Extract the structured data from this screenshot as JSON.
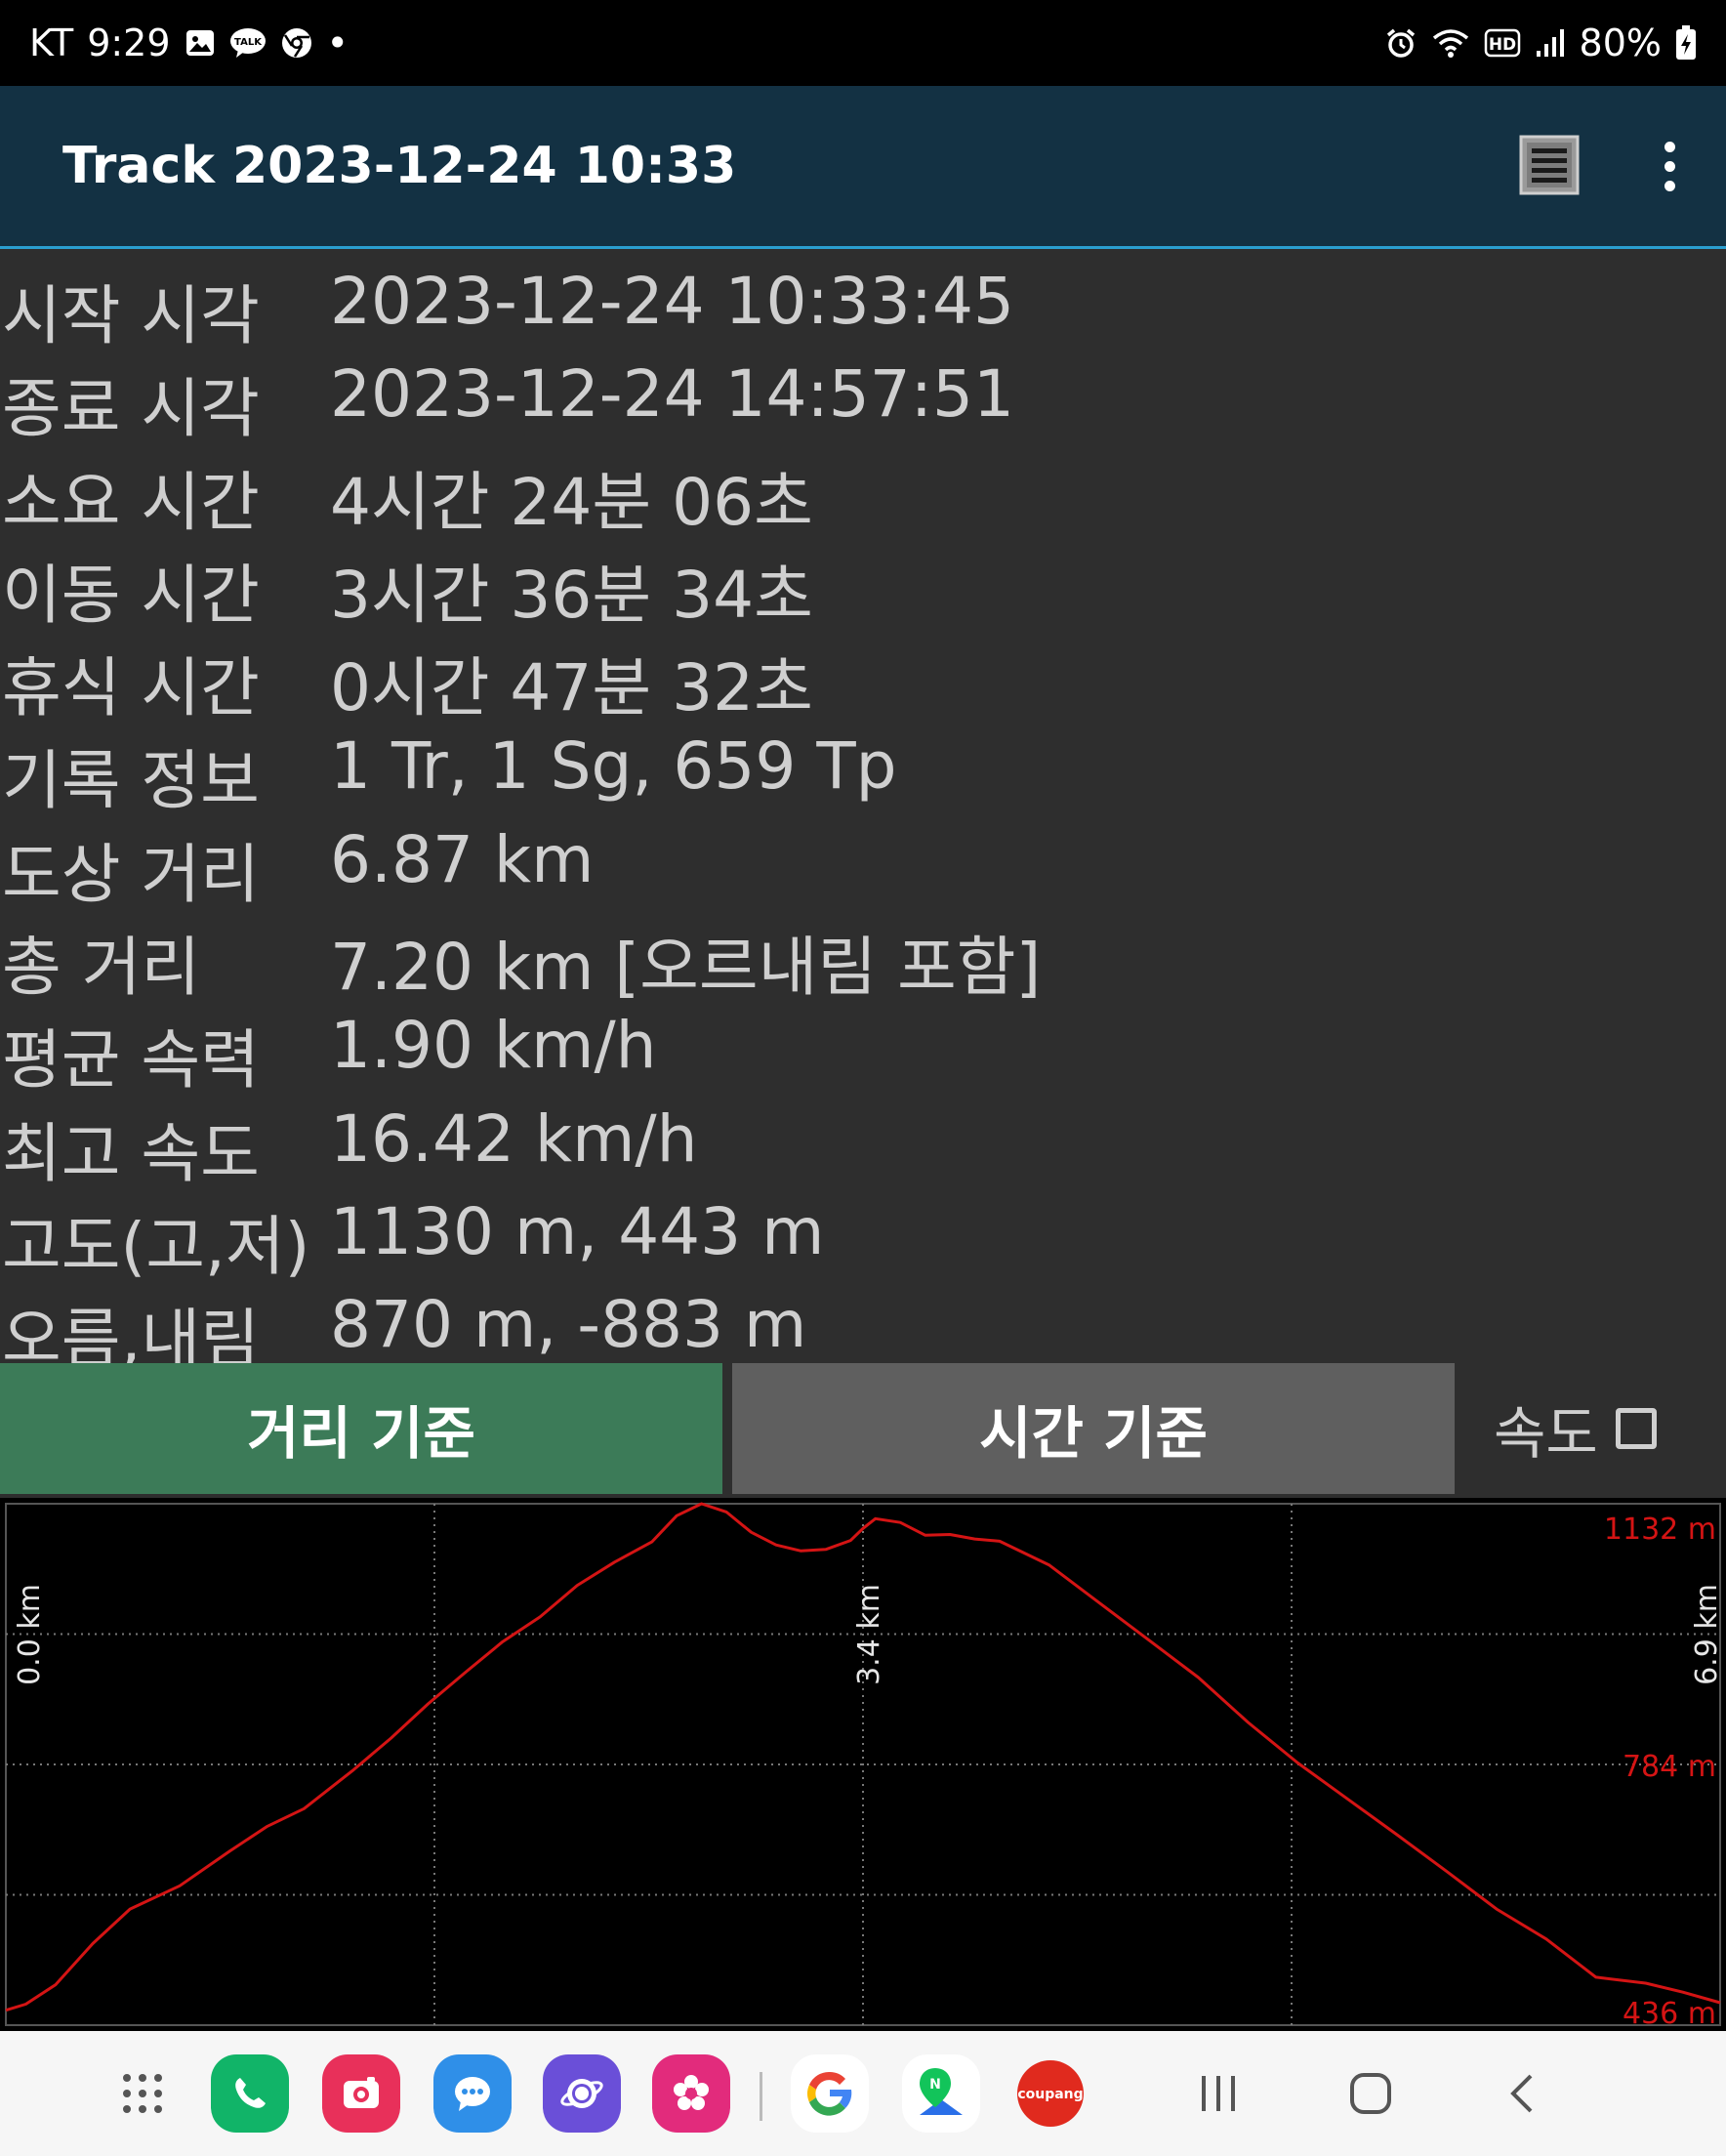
{
  "status_bar": {
    "carrier": "KT",
    "time": "9:29",
    "dot": "•",
    "hd": "HD",
    "battery": "80%",
    "icons_left": [
      "gallery-icon",
      "kakaotalk-icon",
      "chrome-icon"
    ],
    "icons_right": [
      "alarm-icon",
      "wifi-icon",
      "hd-voice-icon",
      "signal-icon",
      "battery-charging-icon"
    ]
  },
  "app_bar": {
    "title": "Track 2023-12-24 10:33",
    "icons": [
      "list-icon",
      "more-vert-icon"
    ]
  },
  "track_info": [
    {
      "label": "시작 시각",
      "value": "2023-12-24 10:33:45"
    },
    {
      "label": "종료 시각",
      "value": "2023-12-24 14:57:51"
    },
    {
      "label": "소요 시간",
      "value": "4시간 24분 06초"
    },
    {
      "label": "이동 시간",
      "value": "3시간 36분 34초"
    },
    {
      "label": "휴식 시간",
      "value": "0시간 47분 32초"
    },
    {
      "label": "기록 정보",
      "value": "1 Tr, 1 Sg, 659 Tp"
    },
    {
      "label": "도상 거리",
      "value": "6.87 km"
    },
    {
      "label": "총 거리",
      "value": "7.20 km [오르내림 포함]"
    },
    {
      "label": "평균 속력",
      "value": "1.90 km/h"
    },
    {
      "label": "최고 속도",
      "value": "16.42 km/h"
    },
    {
      "label": "고도(고,저)",
      "value": "1130 m, 443 m"
    },
    {
      "label": "오름,내림",
      "value": "870 m, -883 m"
    }
  ],
  "tabs": {
    "distance": "거리 기준",
    "time": "시간 기준",
    "speed": "속도"
  },
  "chart_data": {
    "type": "line",
    "x_axis_labels": [
      "0.0 km",
      "3.4 km",
      "6.9 km"
    ],
    "y_axis_labels": [
      "1132 m",
      "784 m",
      "436 m"
    ],
    "xlim": [
      0,
      6.9
    ],
    "ylim": [
      436,
      1132
    ],
    "grid": true,
    "line_color": "#d41414",
    "x": [
      0.0,
      0.08,
      0.2,
      0.35,
      0.5,
      0.7,
      0.9,
      1.05,
      1.2,
      1.4,
      1.55,
      1.7,
      1.85,
      2.0,
      2.15,
      2.3,
      2.45,
      2.6,
      2.7,
      2.8,
      2.9,
      3.0,
      3.1,
      3.2,
      3.3,
      3.4,
      3.45,
      3.5,
      3.6,
      3.7,
      3.8,
      3.9,
      4.0,
      4.2,
      4.4,
      4.6,
      4.8,
      5.0,
      5.2,
      5.4,
      5.6,
      5.8,
      6.0,
      6.2,
      6.4,
      6.6,
      6.75,
      6.9
    ],
    "y": [
      456,
      464,
      490,
      545,
      591,
      622,
      668,
      701,
      725,
      777,
      819,
      865,
      907,
      948,
      981,
      1023,
      1054,
      1081,
      1116,
      1132,
      1121,
      1094,
      1077,
      1069,
      1071,
      1083,
      1099,
      1112,
      1107,
      1090,
      1091,
      1085,
      1082,
      1050,
      1000,
      950,
      900,
      840,
      786,
      738,
      690,
      641,
      591,
      551,
      500,
      492,
      480,
      466
    ]
  },
  "nav_bar": {
    "apps": [
      "apps-grid-icon",
      "phone-icon",
      "camera-icon",
      "messages-icon",
      "internet-icon",
      "flower-icon",
      "google-icon",
      "naver-map-icon",
      "coupang-icon"
    ],
    "nav_letter": "N",
    "coupang_label": "coupang",
    "buttons": [
      "recents-icon",
      "home-icon",
      "back-icon"
    ]
  },
  "colors": {
    "app_bar": "#133143",
    "accent_line": "#2a9fd0",
    "tab_active": "#3c7b58",
    "tab_inactive": "#5f5f5f",
    "background": "#2e2e2e",
    "chart_line": "#d41414"
  }
}
